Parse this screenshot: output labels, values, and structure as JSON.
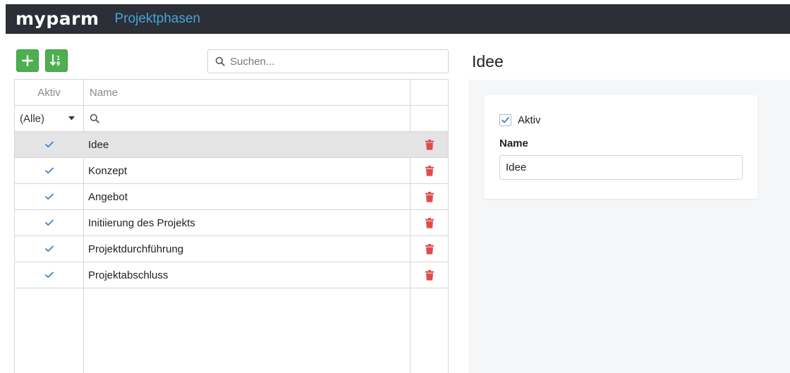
{
  "header": {
    "logo": "myparm",
    "title": "Projektphasen"
  },
  "toolbar": {
    "search_placeholder": "Suchen..."
  },
  "grid": {
    "columns": {
      "aktiv": "Aktiv",
      "name": "Name"
    },
    "filter": {
      "aktiv_selected": "(Alle)"
    },
    "rows": [
      {
        "active": true,
        "name": "Idee"
      },
      {
        "active": true,
        "name": "Konzept"
      },
      {
        "active": true,
        "name": "Angebot"
      },
      {
        "active": true,
        "name": "Initiierung des Projekts"
      },
      {
        "active": true,
        "name": "Projektdurchführung"
      },
      {
        "active": true,
        "name": "Projektabschluss"
      }
    ]
  },
  "detail": {
    "title": "Idee",
    "aktiv_label": "Aktiv",
    "aktiv_checked": true,
    "name_label": "Name",
    "name_value": "Idee"
  },
  "colors": {
    "header_bg": "#2c2f36",
    "title_accent": "#46a3dc",
    "button_green": "#4caf50",
    "check_blue": "#2f7fd0",
    "delete_red": "#e14b4b",
    "selected_row": "#e4e4e4"
  },
  "icons": {
    "add": "plus-icon",
    "sort": "sort-icon",
    "search": "search-icon",
    "filter_dropdown": "caret-down-icon",
    "active": "check-icon",
    "delete": "trash-icon"
  }
}
